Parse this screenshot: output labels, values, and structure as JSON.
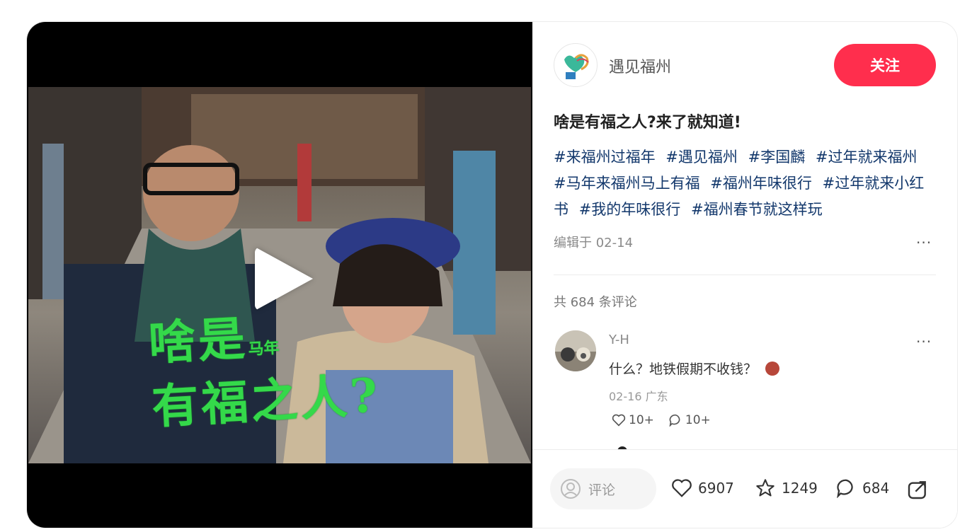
{
  "video": {
    "overlay_line1": "啥是",
    "overlay_small": "马年",
    "overlay_line2": "有福之人?"
  },
  "author": {
    "name": "遇见福州"
  },
  "follow_label": "关注",
  "post": {
    "title": "啥是有福之人?来了就知道!",
    "tags": [
      "#来福州过福年",
      "#遇见福州",
      "#李国麟",
      "#过年就来福州",
      "#马年来福州马上有福",
      "#福州年味很行",
      "#过年就来小红书",
      "#我的年味很行",
      "#福州春节就这样玩"
    ],
    "edited": "编辑于 02-14"
  },
  "comments": {
    "count_label": "共 684 条评论",
    "items": [
      {
        "user": "Y-H",
        "text": "什么？地铁假期不收钱？",
        "meta": "02-16 广东",
        "likes": "10+",
        "replies": "10+"
      }
    ]
  },
  "bottom_bar": {
    "comment_placeholder": "评论",
    "likes": "6907",
    "collects": "1249",
    "comments": "684"
  },
  "colors": {
    "accent": "#ff2e4d",
    "tag": "#13386c",
    "overlay_green": "#34d94a"
  },
  "icons": [
    "play-icon",
    "heart-icon",
    "star-icon",
    "comment-icon",
    "share-icon",
    "user-icon",
    "more-icon"
  ]
}
